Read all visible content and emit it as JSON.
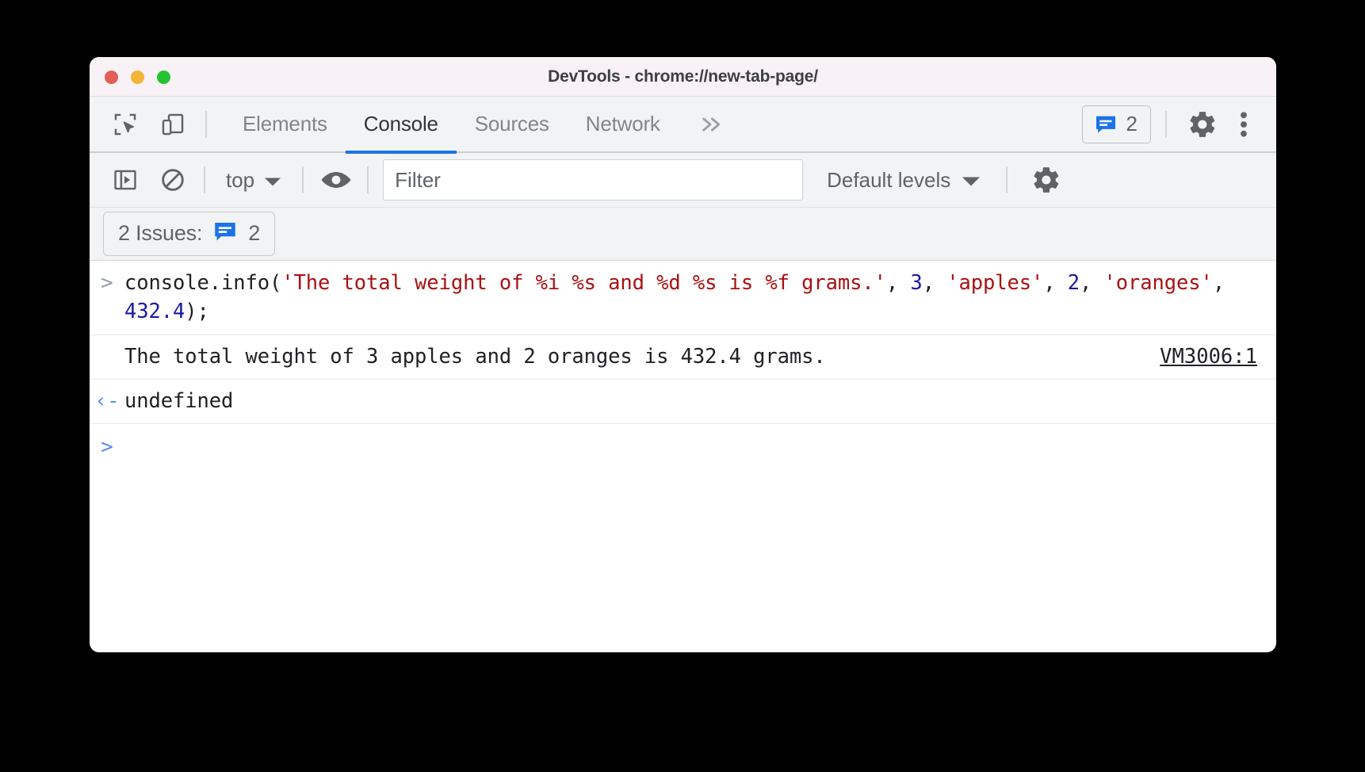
{
  "window": {
    "title": "DevTools - chrome://new-tab-page/",
    "traffic_lights": [
      {
        "name": "close",
        "color": "#e15f55"
      },
      {
        "name": "minimize",
        "color": "#f2b536"
      },
      {
        "name": "maximize",
        "color": "#23c431"
      }
    ]
  },
  "tabbar": {
    "inspect_tooltip": "Inspect element",
    "device_tooltip": "Toggle device toolbar",
    "tabs": [
      {
        "label": "Elements",
        "active": false
      },
      {
        "label": "Console",
        "active": true
      },
      {
        "label": "Sources",
        "active": false
      },
      {
        "label": "Network",
        "active": false
      }
    ],
    "more_tabs_glyph": "»",
    "issues_count": "2",
    "settings_tooltip": "Settings",
    "menu_tooltip": "Customize and control DevTools",
    "active_underline_color": "#1a73e8"
  },
  "console_toolbar": {
    "context_value": "top",
    "filter_placeholder": "Filter",
    "filter_value": "",
    "levels_value": "Default levels",
    "dropdown_glyph": "▼"
  },
  "issues_bar": {
    "label": "2 Issues:",
    "count": "2",
    "icon_color": "#1a73e8"
  },
  "console": {
    "input_caret": ">",
    "output_caret": "‹-",
    "prompt_caret": ">",
    "command_tokens": [
      {
        "text": "console.info(",
        "type": "plain"
      },
      {
        "text": "'The total weight of %i %s and %d %s is %f grams.'",
        "type": "string"
      },
      {
        "text": ", ",
        "type": "plain"
      },
      {
        "text": "3",
        "type": "number"
      },
      {
        "text": ", ",
        "type": "plain"
      },
      {
        "text": "'apples'",
        "type": "string"
      },
      {
        "text": ", ",
        "type": "plain"
      },
      {
        "text": "2",
        "type": "number"
      },
      {
        "text": ", ",
        "type": "plain"
      },
      {
        "text": "'oranges'",
        "type": "string"
      },
      {
        "text": ", ",
        "type": "plain"
      },
      {
        "text": "432.4",
        "type": "number"
      },
      {
        "text": ");",
        "type": "plain"
      }
    ],
    "output_text": "The total weight of 3 apples and 2 oranges is 432.4 grams.",
    "output_source": "VM3006:1",
    "return_value": "undefined"
  },
  "colors": {
    "accent_blue": "#1a73e8",
    "string_red": "#aa1111",
    "number_blue": "#1a1aa6",
    "toolbar_bg": "#f1f3f4",
    "titlebar_bg": "#f8f1f5"
  }
}
